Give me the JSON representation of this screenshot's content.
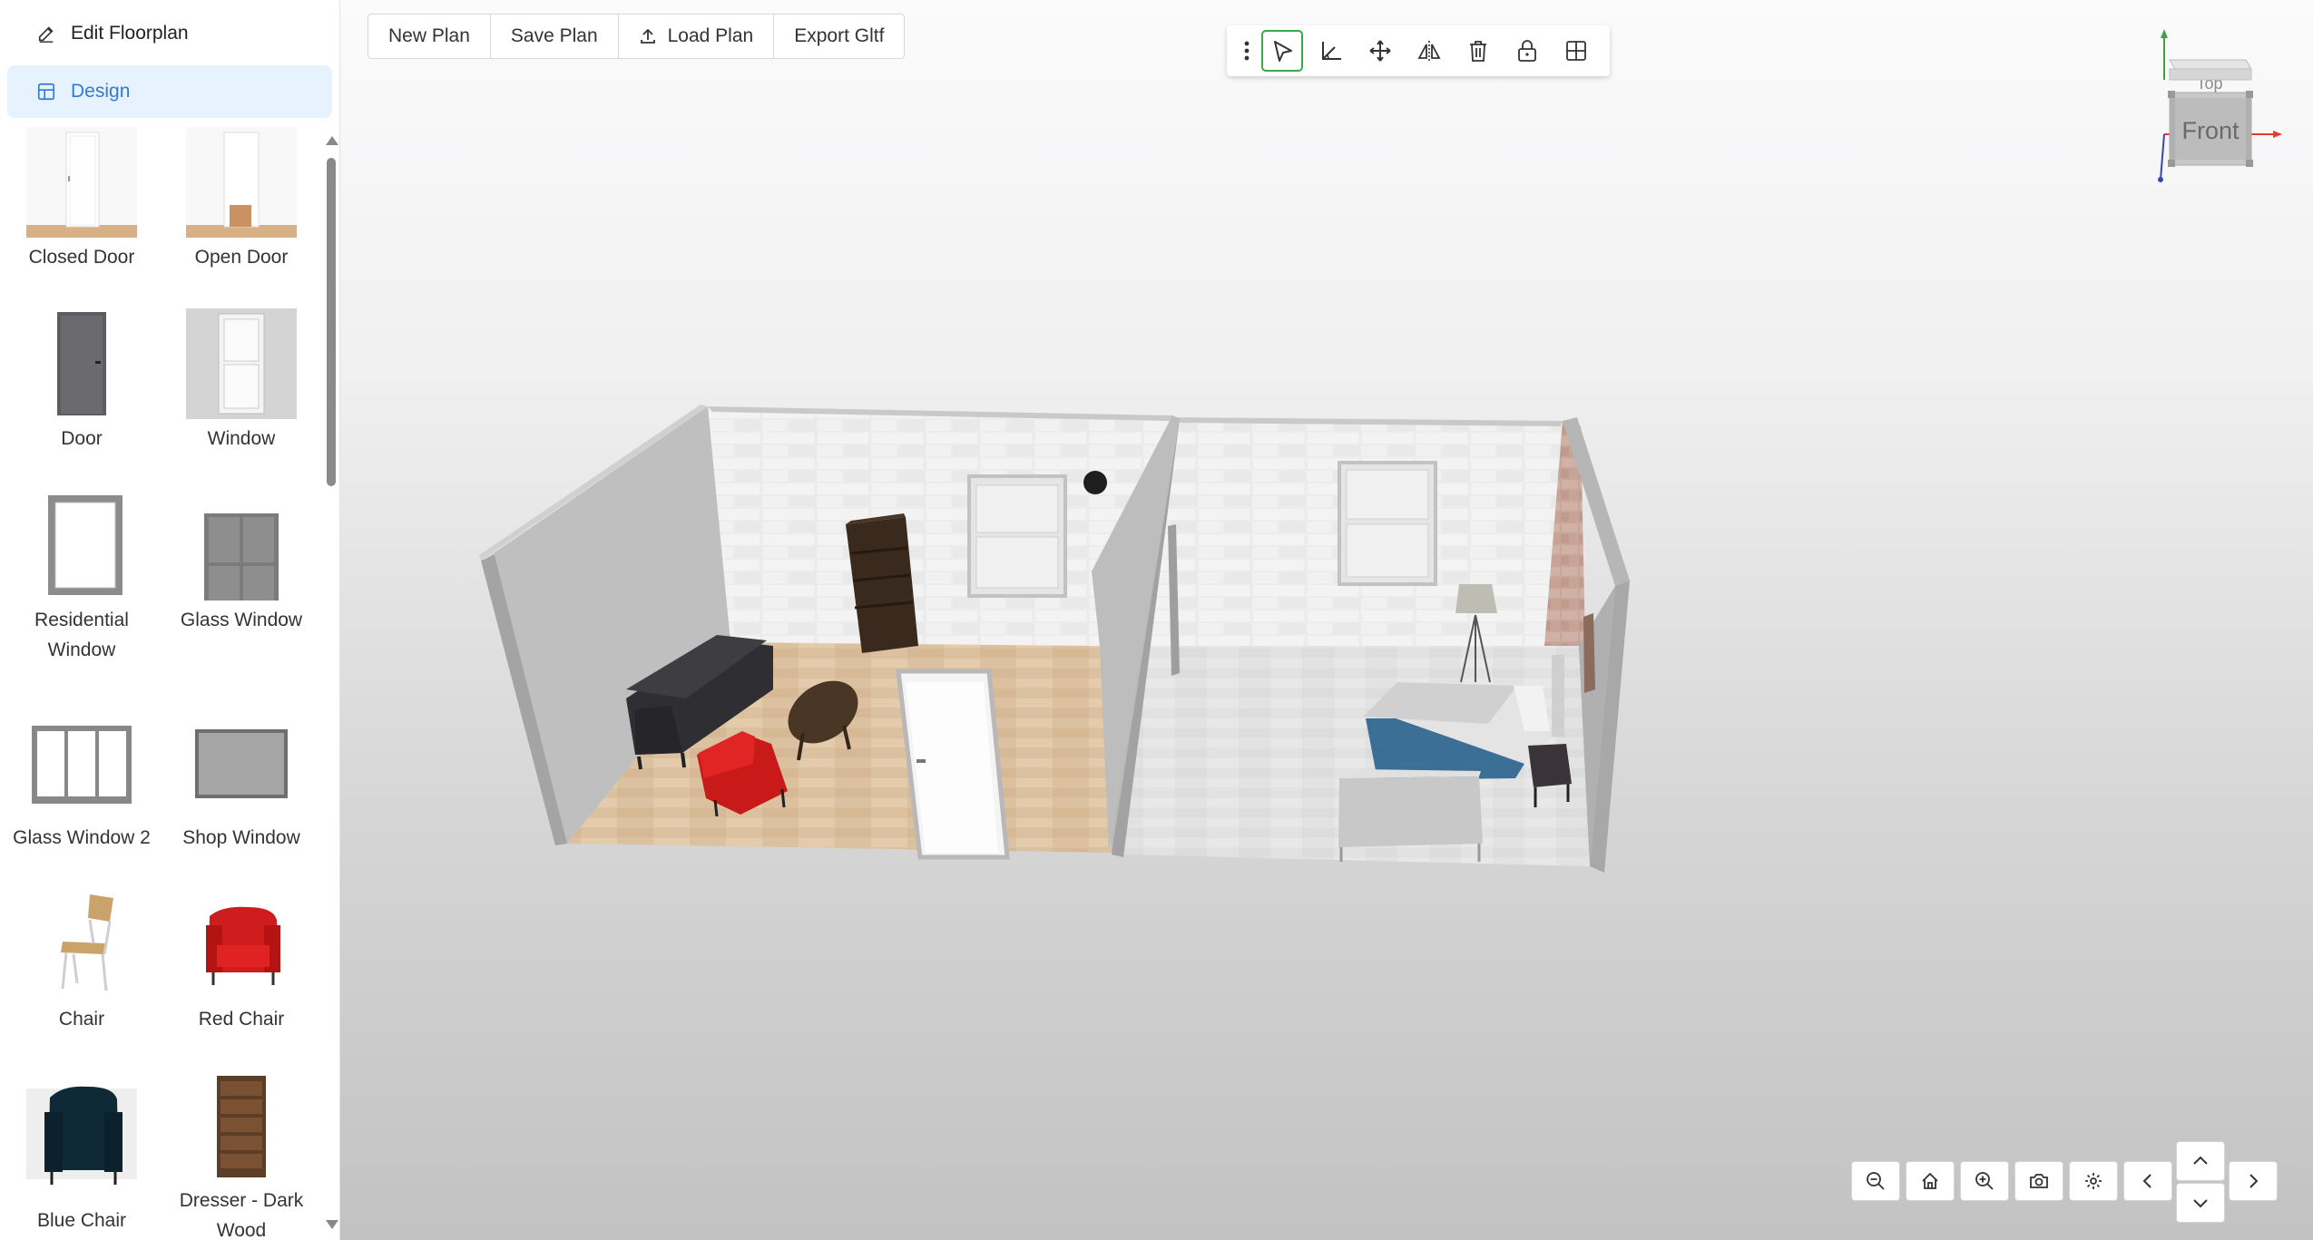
{
  "sidebar": {
    "nav": [
      {
        "label": "Edit Floorplan",
        "icon": "pencil-icon"
      },
      {
        "label": "Design",
        "icon": "floorplan-icon"
      }
    ],
    "catalog": [
      {
        "label": "Closed Door",
        "icon": "closed-door-thumbnail"
      },
      {
        "label": "Open Door",
        "icon": "open-door-thumbnail"
      },
      {
        "label": "Door",
        "icon": "door-thumbnail"
      },
      {
        "label": "Window",
        "icon": "window-thumbnail"
      },
      {
        "label": "Residential Window",
        "icon": "residential-window-thumbnail"
      },
      {
        "label": "Glass Window",
        "icon": "glass-window-thumbnail"
      },
      {
        "label": "Glass Window 2",
        "icon": "glass-window-2-thumbnail"
      },
      {
        "label": "Shop Window",
        "icon": "shop-window-thumbnail"
      },
      {
        "label": "Chair",
        "icon": "chair-thumbnail"
      },
      {
        "label": "Red Chair",
        "icon": "red-chair-thumbnail"
      },
      {
        "label": "Blue Chair",
        "icon": "blue-chair-thumbnail"
      },
      {
        "label": "Dresser - Dark Wood",
        "icon": "dresser-thumbnail"
      }
    ]
  },
  "topbar": {
    "new_plan": "New Plan",
    "save_plan": "Save Plan",
    "load_plan": "Load Plan",
    "export_gltf": "Export Gltf"
  },
  "toolbar": {
    "tools": [
      "more-options-icon",
      "select-icon",
      "measure-icon",
      "move-icon",
      "mirror-icon",
      "delete-icon",
      "lock-icon",
      "grid-icon"
    ],
    "active_tool": "select-icon"
  },
  "viewcube": {
    "top_label": "Top",
    "front_label": "Front",
    "axis_colors": {
      "x": "#e53935",
      "y": "#43a047",
      "z": "#3949ab"
    }
  },
  "bottom_controls": [
    "zoom-out-icon",
    "home-icon",
    "zoom-in-icon",
    "camera-icon",
    "settings-icon",
    "pan-left-icon",
    "pan-up-icon",
    "pan-down-icon",
    "pan-right-icon"
  ],
  "colors": {
    "accent": "#2f7bd6",
    "active_tool_border": "#3aa84c",
    "nav_active_bg": "#e6f2fd"
  }
}
